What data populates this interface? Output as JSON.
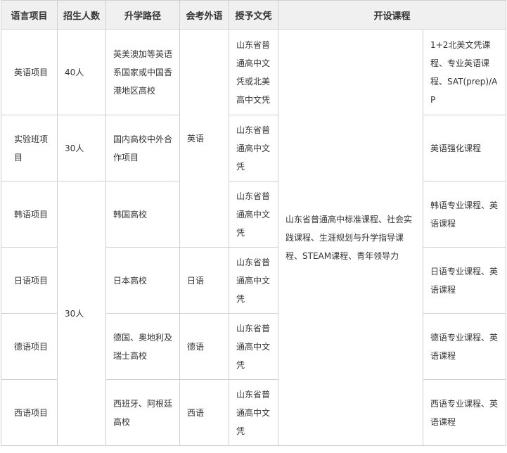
{
  "headers": [
    "语言项目",
    "招生人数",
    "升学路径",
    "会考外语",
    "授予文凭",
    "开设课程"
  ],
  "rows": [
    {
      "lang": "英语项目",
      "count": "40人",
      "path": "英美澳加等英语系国家或中国香港地区高校",
      "diploma": "山东省普通高中文凭或北美高中文凭",
      "course": "1+2北美文凭课程、专业英语课程、SAT(prep)/AP"
    },
    {
      "lang": "实验班项目",
      "count": "30人",
      "path": "国内高校中外合作项目",
      "diploma": "山东省普通高中文凭",
      "course": "英语强化课程"
    },
    {
      "lang": "韩语项目",
      "path": "韩国高校",
      "diploma": "山东省普通高中文凭",
      "course": "韩语专业课程、英语课程"
    },
    {
      "lang": "日语项目",
      "path": "日本高校",
      "exam": "日语",
      "diploma": "山东省普通高中文凭",
      "course": "日语专业课程、英语课程"
    },
    {
      "lang": "德语项目",
      "path": "德国、奥地利及瑞士高校",
      "exam": "德语",
      "diploma": "山东省普通高中文凭",
      "course": "德语专业课程、英语课程"
    },
    {
      "lang": "西语项目",
      "path": "西班牙、阿根廷高校",
      "exam": "西语",
      "diploma": "山东省普通高中文凭",
      "course": "西语专业课程、英语课程"
    }
  ],
  "merged": {
    "count_rest": "30人",
    "exam_english": "英语",
    "common_courses": "山东省普通高中标准课程、社会实践课程、生涯规划与升学指导课程、STEAM课程、青年领导力"
  }
}
